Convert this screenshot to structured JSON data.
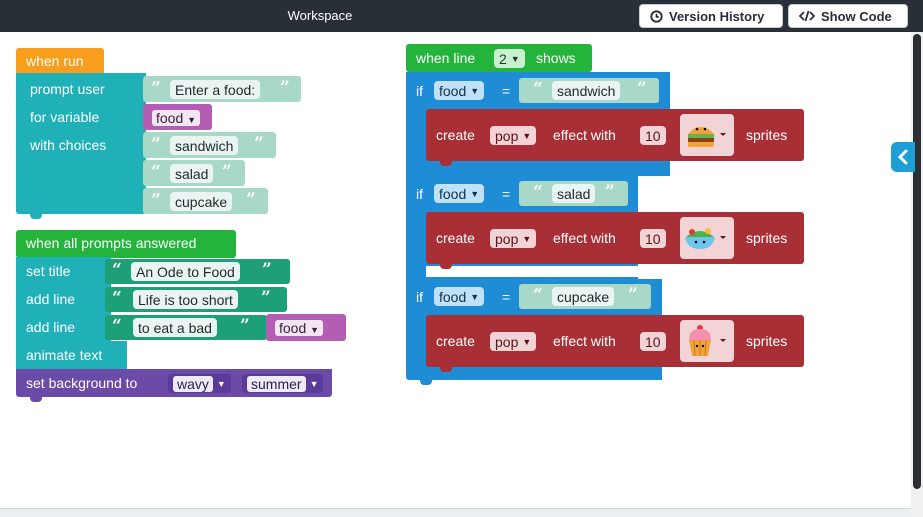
{
  "header": {
    "title": "Workspace",
    "version_history": "Version History",
    "show_code": "Show Code"
  },
  "icons": {
    "history": "clock-icon",
    "code": "code-icon",
    "collapse": "chevron-left-icon"
  },
  "colors": {
    "topbar": "#292f36",
    "event_orange": "#f99d1c",
    "event_green": "#24b33b",
    "prompt_teal": "#1fb0b8",
    "text_green": "#1d9f78",
    "sprites_red": "#a82f36",
    "control_blue": "#1e8dd6",
    "background_purple": "#6b4aa8",
    "variable_purple": "#b35db3"
  },
  "blocks": {
    "when_run": {
      "hat": "when run",
      "prompt_user": "prompt user",
      "prompt_text": "Enter a food:",
      "for_variable": "for variable",
      "variable": "food",
      "with_choices": "with choices",
      "choices": [
        "sandwich",
        "salad",
        "cupcake"
      ]
    },
    "all_answered": {
      "hat": "when all prompts answered",
      "set_title": "set title",
      "title_text": "An Ode to Food",
      "add_line_1": "add line",
      "line_1_text": "Life is too short",
      "add_line_2": "add line",
      "line_2_text": "to eat a bad",
      "line_2_var": "food",
      "animate_text": "animate text",
      "set_background": "set background to",
      "bg_style": "wavy",
      "bg_theme": "summer"
    },
    "when_line": {
      "hat_prefix": "when line",
      "line_number": "2",
      "hat_suffix": "shows",
      "conditions": [
        {
          "if_label": "if",
          "var": "food",
          "op": "=",
          "value": "sandwich",
          "create": "create",
          "effect": "pop",
          "effect_with": "effect with",
          "count": "10",
          "sprite": "burger",
          "sprites": "sprites"
        },
        {
          "if_label": "if",
          "var": "food",
          "op": "=",
          "value": "salad",
          "create": "create",
          "effect": "pop",
          "effect_with": "effect with",
          "count": "10",
          "sprite": "salad-bowl",
          "sprites": "sprites"
        },
        {
          "if_label": "if",
          "var": "food",
          "op": "=",
          "value": "cupcake",
          "create": "create",
          "effect": "pop",
          "effect_with": "effect with",
          "count": "10",
          "sprite": "cupcake",
          "sprites": "sprites"
        }
      ]
    }
  }
}
